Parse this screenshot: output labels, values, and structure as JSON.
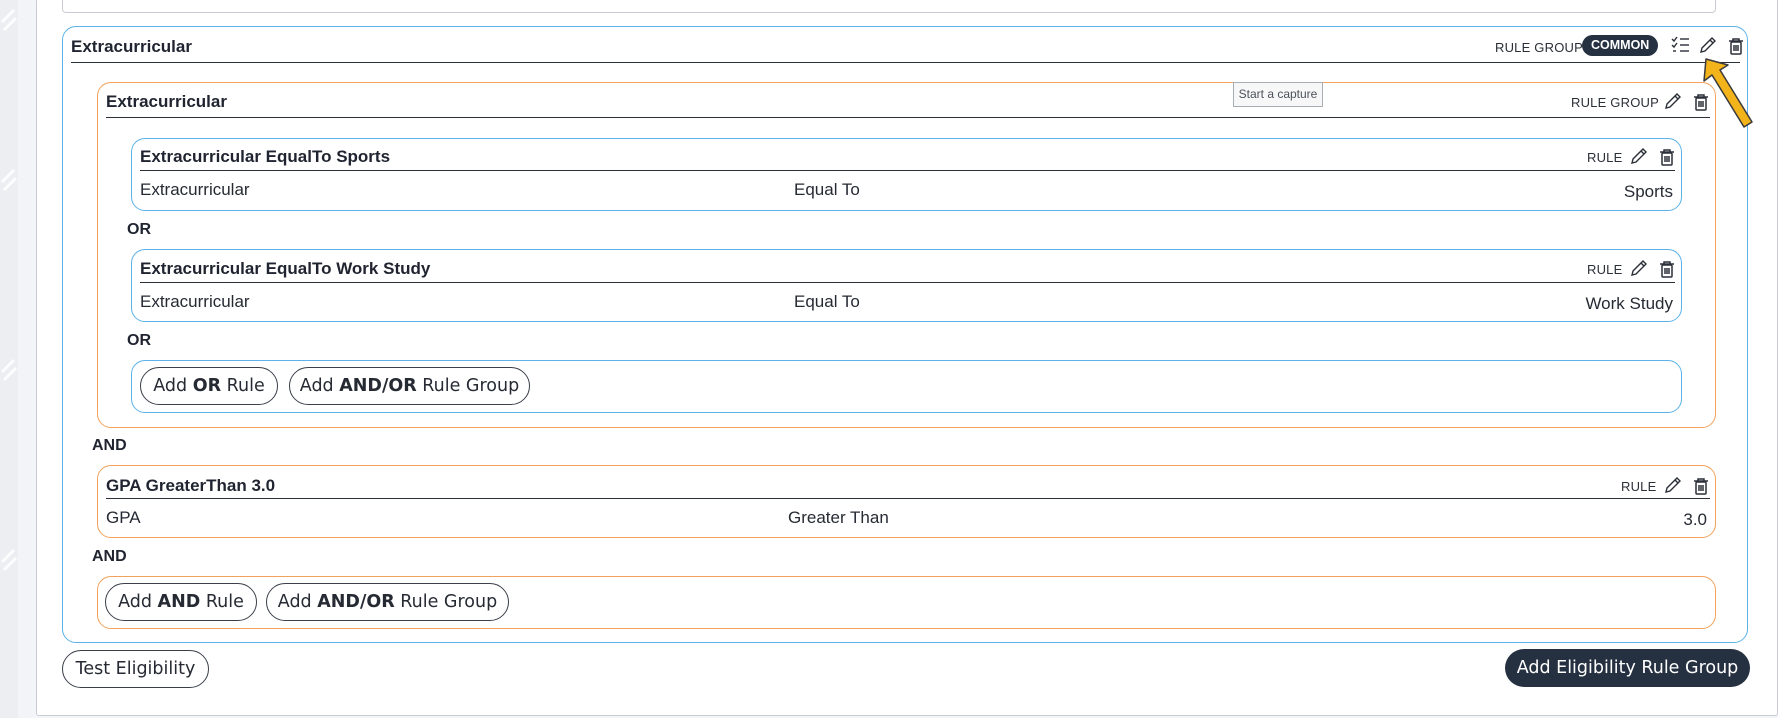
{
  "colors": {
    "blue_border": "#5bb3ea",
    "orange_border": "#f2a25a",
    "badge_bg": "#253041",
    "primary_button_bg": "#253041"
  },
  "outer_group": {
    "title": "Extracurricular",
    "kind": "RULE GROUP",
    "badge": "COMMON",
    "icons": [
      "checklist-icon",
      "pencil-icon",
      "trash-icon"
    ]
  },
  "inner_group": {
    "title": "Extracurricular",
    "kind": "RULE GROUP",
    "icons": [
      "pencil-icon",
      "trash-icon"
    ]
  },
  "rules": [
    {
      "title": "Extracurricular EqualTo Sports",
      "kind": "RULE",
      "field": "Extracurricular",
      "operator": "Equal To",
      "value": "Sports"
    },
    {
      "title": "Extracurricular EqualTo Work Study",
      "kind": "RULE",
      "field": "Extracurricular",
      "operator": "Equal To",
      "value": "Work Study"
    },
    {
      "title": "GPA GreaterThan 3.0",
      "kind": "RULE",
      "field": "GPA",
      "operator": "Greater Than",
      "value": "3.0"
    }
  ],
  "connectors": {
    "or": "OR",
    "and": "AND"
  },
  "inner_actions": {
    "add_or_rule": {
      "pre": "Add ",
      "bold": "OR",
      "post": " Rule"
    },
    "add_group": {
      "pre": "Add ",
      "bold": "AND/OR",
      "post": " Rule Group"
    }
  },
  "outer_actions": {
    "add_and_rule": {
      "pre": "Add ",
      "bold": "AND",
      "post": " Rule"
    },
    "add_group": {
      "pre": "Add ",
      "bold": "AND/OR",
      "post": " Rule Group"
    }
  },
  "footer": {
    "test_eligibility": "Test Eligibility",
    "add_eligibility_rule_group": "Add Eligibility Rule Group"
  },
  "tooltip": "Start a capture"
}
